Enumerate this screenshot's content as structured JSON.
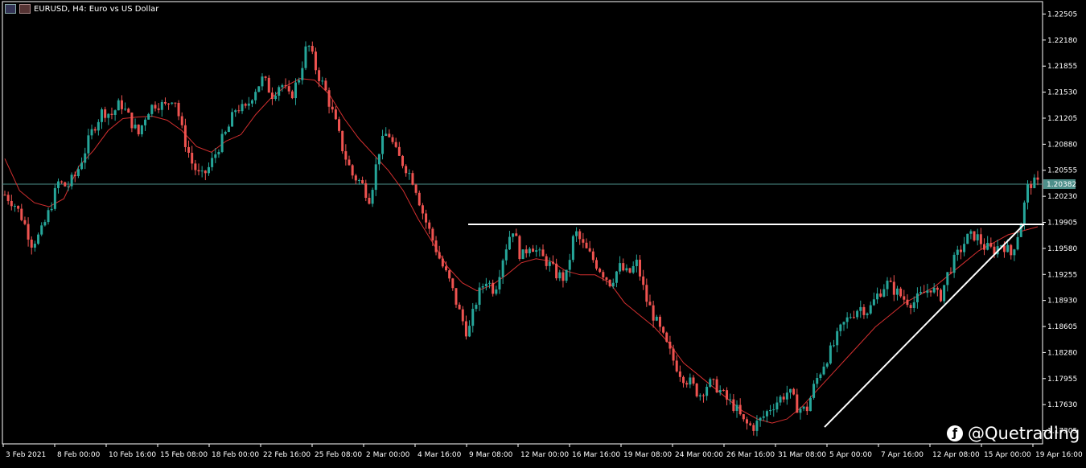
{
  "header": {
    "symbol_label": "EURUSD, H4:  Euro vs US Dollar"
  },
  "watermark": {
    "text": "@Quetrading"
  },
  "chart_data": {
    "type": "candlestick",
    "ylim": [
      1.1714,
      1.2266
    ],
    "yticks": [
      "1.22505",
      "1.22180",
      "1.21855",
      "1.21530",
      "1.21205",
      "1.20880",
      "1.20555",
      "1.20230",
      "1.19905",
      "1.19580",
      "1.19255",
      "1.18930",
      "1.18605",
      "1.18280",
      "1.17955",
      "1.17630",
      "1.17305"
    ],
    "current_price": "1.20382",
    "current_price_value": 1.20382,
    "xticks": [
      "3 Feb 2021",
      "8 Feb 00:00",
      "10 Feb 16:00",
      "15 Feb 08:00",
      "18 Feb 00:00",
      "22 Feb 16:00",
      "25 Feb 08:00",
      "2 Mar 00:00",
      "4 Mar 16:00",
      "9 Mar 08:00",
      "12 Mar 00:00",
      "16 Mar 16:00",
      "19 Mar 08:00",
      "24 Mar 00:00",
      "26 Mar 16:00",
      "31 Mar 08:00",
      "5 Apr 00:00",
      "7 Apr 16:00",
      "12 Apr 08:00",
      "15 Apr 00:00",
      "19 Apr 16:00"
    ],
    "close_path": [
      1.2025,
      1.2015,
      1.1995,
      1.1965,
      1.1975,
      1.2005,
      1.204,
      1.2035,
      1.205,
      1.208,
      1.211,
      1.213,
      1.2125,
      1.214,
      1.212,
      1.21,
      1.213,
      1.214,
      1.2135,
      1.215,
      1.21,
      1.2065,
      1.2045,
      1.206,
      1.2085,
      1.2105,
      1.2135,
      1.213,
      1.2155,
      1.217,
      1.215,
      1.2165,
      1.2145,
      1.217,
      1.2215,
      1.218,
      1.2155,
      1.212,
      1.208,
      1.205,
      1.204,
      1.202,
      1.208,
      1.2105,
      1.2075,
      1.206,
      1.204,
      1.2,
      1.197,
      1.194,
      1.1915,
      1.188,
      1.185,
      1.1895,
      1.192,
      1.1905,
      1.195,
      1.1985,
      1.1945,
      1.1965,
      1.195,
      1.194,
      1.1925,
      1.192,
      1.198,
      1.196,
      1.1945,
      1.193,
      1.1915,
      1.1935,
      1.1925,
      1.194,
      1.1895,
      1.187,
      1.1845,
      1.182,
      1.18,
      1.179,
      1.1775,
      1.179,
      1.1785,
      1.177,
      1.176,
      1.174,
      1.1735,
      1.1745,
      1.176,
      1.177,
      1.178,
      1.176,
      1.1755,
      1.179,
      1.1815,
      1.1835,
      1.186,
      1.1875,
      1.1885,
      1.188,
      1.19,
      1.1915,
      1.1905,
      1.1895,
      1.189,
      1.19,
      1.191,
      1.1895,
      1.193,
      1.195,
      1.197,
      1.1975,
      1.196,
      1.1955,
      1.1965,
      1.195,
      1.1985,
      1.204,
      1.2038
    ],
    "ma_path": [
      1.207,
      1.203,
      1.2015,
      1.201,
      1.202,
      1.206,
      1.208,
      1.2105,
      1.212,
      1.2122,
      1.2123,
      1.2118,
      1.2105,
      1.2085,
      1.2078,
      1.2092,
      1.21,
      1.2125,
      1.2145,
      1.216,
      1.217,
      1.2168,
      1.215,
      1.212,
      1.2095,
      1.2075,
      1.2055,
      1.203,
      1.1995,
      1.1965,
      1.1935,
      1.1915,
      1.1905,
      1.1912,
      1.1925,
      1.194,
      1.1945,
      1.1942,
      1.193,
      1.1925,
      1.1925,
      1.1915,
      1.189,
      1.1875,
      1.186,
      1.184,
      1.1815,
      1.18,
      1.1785,
      1.177,
      1.1755,
      1.1745,
      1.174,
      1.1745,
      1.176,
      1.178,
      1.18,
      1.182,
      1.184,
      1.186,
      1.1875,
      1.189,
      1.19,
      1.191,
      1.1925,
      1.194,
      1.1955,
      1.1965,
      1.1975,
      1.198,
      1.1985
    ],
    "resistance_line": {
      "price": 1.1988,
      "from_label": "9 Mar 08:00",
      "to_label": "19 Apr 16:00"
    },
    "trend_line": {
      "from_label": "5 Apr 00:00",
      "from_price": 1.1735,
      "to_label": "19 Apr 16:00",
      "to_price": 1.1988
    },
    "colors": {
      "bull": "#26a69a",
      "bear": "#ef5350",
      "ma": "#d32f2f",
      "price_line": "#4d8f8a",
      "trend": "#ffffff",
      "axis": "#ffffff"
    }
  }
}
